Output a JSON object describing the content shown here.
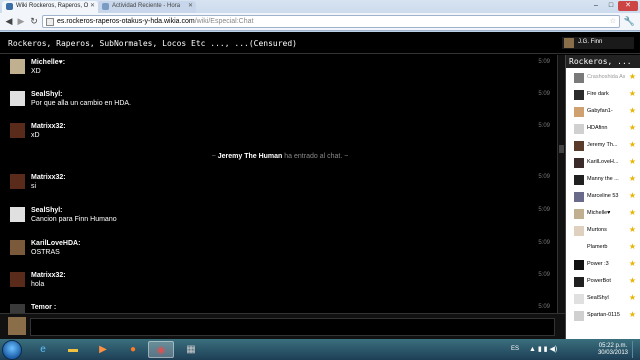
{
  "browser": {
    "tabs": [
      {
        "title": "Wiki Rockeros, Raperos, O",
        "active": true
      },
      {
        "title": "Actividad Reciente - Hora",
        "active": false
      }
    ],
    "url_host": "es.rockeros-raperos-otakus-y-hda.wikia.com",
    "url_path": "/wiki/Especial:Chat",
    "controls": {
      "minimize": "–",
      "maximize": "□",
      "close": "✕"
    }
  },
  "chat": {
    "room_title": "Rockeros, Raperos, SubNormales, Locos Etc ..., ...(Censured)",
    "current_user": "J.G. Finn",
    "messages": [
      {
        "user": "Michelle♥:",
        "text": "XD",
        "time": "5:09"
      },
      {
        "user": "SealShyl:",
        "text": "Por que alla un cambio en HDA.",
        "time": "5:09"
      },
      {
        "user": "Matrixx32:",
        "text": "xD",
        "time": "5:09"
      },
      {
        "user": "Matrixx32:",
        "text": "si",
        "time": "5:09"
      },
      {
        "user": "SealShyl:",
        "text": "Cancion para Finn Humano",
        "time": "5:09"
      },
      {
        "user": "KarilLoveHDA:",
        "text": "OSTRAS",
        "time": "5:09"
      },
      {
        "user": "Matrixx32:",
        "text": "hola",
        "time": "5:09"
      },
      {
        "user": "Temor :",
        "text": "",
        "time": "5:09"
      }
    ],
    "alert": {
      "prefix": "~ ",
      "user": "Jeremy The Human",
      "text": " ha entrado al chat. ~"
    },
    "composer_value": ""
  },
  "userlist": {
    "title": "Rockeros, ...",
    "users": [
      {
        "name": "Crashoshida Assasins",
        "away": true
      },
      {
        "name": "Fire dark",
        "away": false
      },
      {
        "name": "Gabyfan1-",
        "away": false
      },
      {
        "name": "HDAfinn",
        "away": false
      },
      {
        "name": "Jeremy Th...",
        "away": false
      },
      {
        "name": "KarilLoveH...",
        "away": false
      },
      {
        "name": "Manny the ...",
        "away": false
      },
      {
        "name": "Marceline 53",
        "away": false
      },
      {
        "name": "Michelle♥",
        "away": false
      },
      {
        "name": "Murtons",
        "away": false
      },
      {
        "name": "Plamerb",
        "away": false
      },
      {
        "name": "Power :3",
        "away": false
      },
      {
        "name": "PowerBot",
        "away": false
      },
      {
        "name": "SealShyl",
        "away": false
      },
      {
        "name": "Spartan-0115",
        "away": false
      }
    ]
  },
  "taskbar": {
    "apps": [
      "internet-explorer",
      "folder",
      "media-player",
      "firefox",
      "chrome",
      "calculator"
    ],
    "language": "ES",
    "time": "05:22 p.m.",
    "date": "30/03/2013"
  },
  "colors": {
    "background": "#000000",
    "star": "#e8b400",
    "taskbar": "#1e3f55"
  }
}
